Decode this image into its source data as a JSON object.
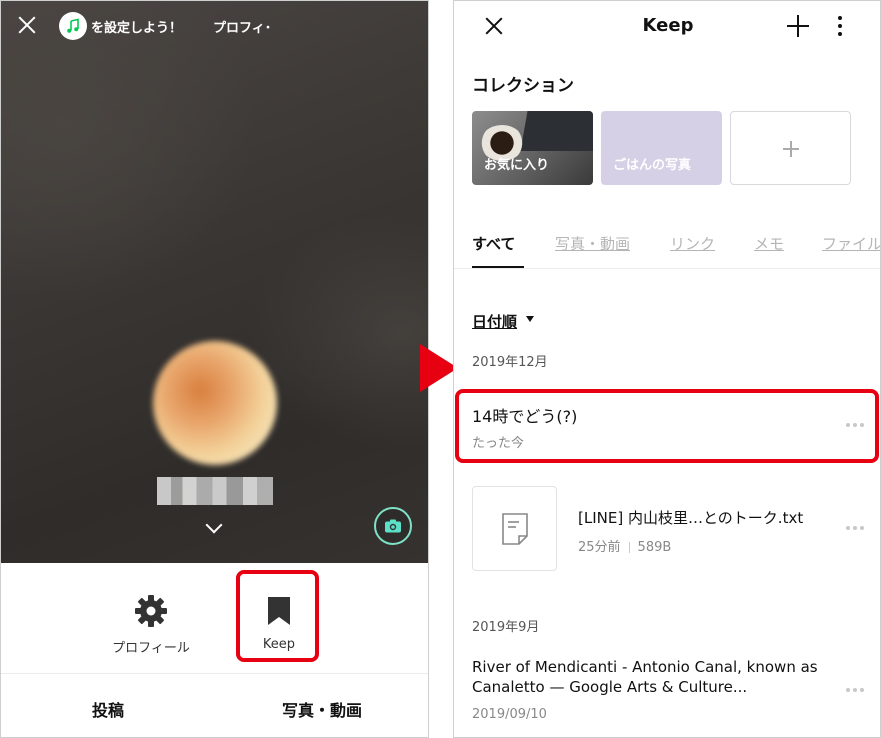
{
  "left_phone": {
    "music_banner_text": "を設定しよう！",
    "profile_partial": "プロフィ･",
    "bottom_menu": {
      "profile_label": "プロフィール",
      "keep_label": "Keep"
    },
    "actions": {
      "post_label": "投稿",
      "photo_video_label": "写真・動画"
    }
  },
  "right_phone": {
    "title": "Keep",
    "collections_title": "コレクション",
    "collections": [
      {
        "label": "お気に入り"
      },
      {
        "label": "ごはんの写真"
      }
    ],
    "tabs": [
      "すべて",
      "写真・動画",
      "リンク",
      "メモ",
      "ファイル"
    ],
    "sort_label": "日付順",
    "groups": [
      {
        "date_header": "2019年12月",
        "items": [
          {
            "title": "14時でどう(?)",
            "subtitle": "たった今"
          },
          {
            "title": "[LINE] 内山枝里…とのトーク.txt",
            "time": "25分前",
            "size": "589B"
          }
        ]
      },
      {
        "date_header": "2019年9月",
        "items": [
          {
            "title": "River of Mendicanti - Antonio Canal, known as Canaletto — Google Arts & Culture...",
            "date": "2019/09/10"
          }
        ]
      }
    ]
  },
  "colors": {
    "highlight_red": "#e60012",
    "line_green": "#06c755"
  }
}
